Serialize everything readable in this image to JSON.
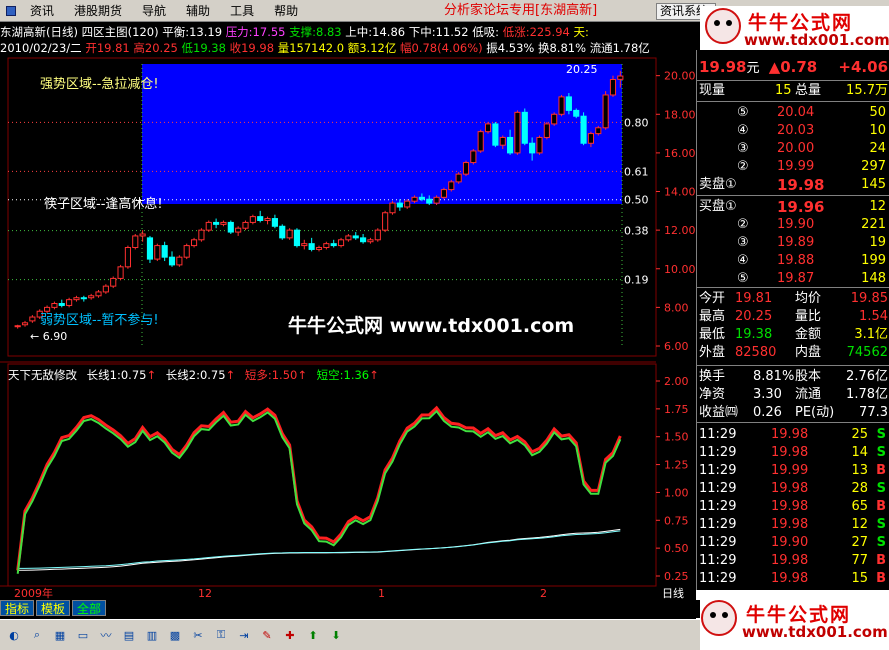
{
  "menu": {
    "items": [
      "资讯",
      "港股期货",
      "导航",
      "辅助",
      "工具",
      "帮助"
    ],
    "title": "分析家论坛专用",
    "title_stock": "[东湖高新]",
    "button": "资讯系统"
  },
  "logo": {
    "text": "牛牛公式网",
    "url": "www.tdx001.com"
  },
  "header": {
    "name": "东湖高新(日线)",
    "view": "四区主图(120)",
    "pingheng": "平衡:13.19",
    "yali": "压力:17.55",
    "zhicheng": "支撑:8.83",
    "shangzhong": "上中:14.86",
    "xiazhong": "下中:11.52",
    "dixi": "低吸:",
    "dizhang": "低涨:225.94",
    "tian": "天:",
    "date": "2010/02/23/二",
    "kai": "开19.81",
    "gao": "高20.25",
    "di": "低19.38",
    "shou": "收19.98",
    "liang": "量157142.0",
    "e": "额3.12亿",
    "fu": "幅0.78(4.06%)",
    "zhen": "振4.53%",
    "huan": "换8.81%",
    "liutong": "流通1.78亿"
  },
  "chart_text": {
    "zone_strong": "强势区域--急拉减仓!",
    "zone_bamboo": "筷子区域--逢高休息!",
    "zone_weak": "弱势区域--暂不参与!",
    "watermark": "牛牛公式网 www.tdx001.com",
    "low_label": "← 6.90",
    "high_label": "20.25",
    "ratio_labels": [
      "0.80",
      "0.61",
      "0.50",
      "0.38",
      "0.19"
    ],
    "price_ticks": [
      "20.00",
      "18.00",
      "16.00",
      "14.00",
      "12.00",
      "10.00",
      "8.00",
      "6.00"
    ],
    "indicator_title": "天下无敌修改",
    "ind_long1": "长线1:0.75",
    "ind_long2": "长线2:0.75",
    "ind_short_long": "短多:1.50",
    "ind_short_empty": "短空:1.36",
    "ind_ticks": [
      "2.00",
      "1.75",
      "1.50",
      "1.25",
      "1.00",
      "0.75",
      "0.50",
      "0.25"
    ],
    "x_labels": [
      "2009年",
      "12",
      "1",
      "2"
    ],
    "day_label": "日线"
  },
  "chart_data": {
    "type": "candlestick",
    "ylim": [
      6.0,
      20.5
    ],
    "candles": [
      [
        7.0,
        7.1,
        7.05,
        6.9
      ],
      [
        7.1,
        7.3,
        7.2,
        7.0
      ],
      [
        7.3,
        7.6,
        7.5,
        7.2
      ],
      [
        7.5,
        7.9,
        7.8,
        7.4
      ],
      [
        7.8,
        8.1,
        8.0,
        7.7
      ],
      [
        8.0,
        8.3,
        8.2,
        7.9
      ],
      [
        8.2,
        8.4,
        8.1,
        8.0
      ],
      [
        8.1,
        8.5,
        8.4,
        8.0
      ],
      [
        8.4,
        8.6,
        8.5,
        8.3
      ],
      [
        8.5,
        8.6,
        8.45,
        8.3
      ],
      [
        8.5,
        8.7,
        8.6,
        8.4
      ],
      [
        8.6,
        8.9,
        8.8,
        8.5
      ],
      [
        8.8,
        9.2,
        9.1,
        8.7
      ],
      [
        9.1,
        9.6,
        9.5,
        9.0
      ],
      [
        9.5,
        10.2,
        10.1,
        9.4
      ],
      [
        10.1,
        11.2,
        11.1,
        10.0
      ],
      [
        11.1,
        11.8,
        11.7,
        11.0
      ],
      [
        11.7,
        12.0,
        11.8,
        11.4
      ],
      [
        11.6,
        11.7,
        10.5,
        10.3
      ],
      [
        10.5,
        11.3,
        11.2,
        10.4
      ],
      [
        11.2,
        11.4,
        10.6,
        10.4
      ],
      [
        10.6,
        10.9,
        10.2,
        10.1
      ],
      [
        10.2,
        10.7,
        10.6,
        10.1
      ],
      [
        10.6,
        11.3,
        11.2,
        10.5
      ],
      [
        11.2,
        11.6,
        11.5,
        11.1
      ],
      [
        11.5,
        12.1,
        12.0,
        11.4
      ],
      [
        12.0,
        12.5,
        12.4,
        11.9
      ],
      [
        12.4,
        12.6,
        12.3,
        12.1
      ],
      [
        12.3,
        12.5,
        12.4,
        12.2
      ],
      [
        12.4,
        12.5,
        11.9,
        11.8
      ],
      [
        11.9,
        12.2,
        12.1,
        11.7
      ],
      [
        12.1,
        12.5,
        12.4,
        12.0
      ],
      [
        12.4,
        12.8,
        12.7,
        12.3
      ],
      [
        12.7,
        13.0,
        12.5,
        12.4
      ],
      [
        12.5,
        12.7,
        12.6,
        12.3
      ],
      [
        12.6,
        12.8,
        12.2,
        12.1
      ],
      [
        12.2,
        12.3,
        11.6,
        11.5
      ],
      [
        11.6,
        12.1,
        12.0,
        11.5
      ],
      [
        12.0,
        12.1,
        11.2,
        11.1
      ],
      [
        11.2,
        11.5,
        11.3,
        11.0
      ],
      [
        11.3,
        11.6,
        11.0,
        10.9
      ],
      [
        11.0,
        11.2,
        11.1,
        10.9
      ],
      [
        11.1,
        11.4,
        11.3,
        11.0
      ],
      [
        11.3,
        11.5,
        11.2,
        11.1
      ],
      [
        11.2,
        11.6,
        11.5,
        11.1
      ],
      [
        11.5,
        11.8,
        11.7,
        11.4
      ],
      [
        11.7,
        11.9,
        11.6,
        11.5
      ],
      [
        11.6,
        11.8,
        11.4,
        11.3
      ],
      [
        11.4,
        11.6,
        11.5,
        11.3
      ],
      [
        11.5,
        12.1,
        12.0,
        11.4
      ],
      [
        12.0,
        13.0,
        12.9,
        11.9
      ],
      [
        12.9,
        13.5,
        13.4,
        12.8
      ],
      [
        13.4,
        13.6,
        13.2,
        13.0
      ],
      [
        13.2,
        13.6,
        13.5,
        13.1
      ],
      [
        13.5,
        13.8,
        13.7,
        13.4
      ],
      [
        13.7,
        13.9,
        13.6,
        13.5
      ],
      [
        13.6,
        13.8,
        13.4,
        13.3
      ],
      [
        13.4,
        13.8,
        13.7,
        13.3
      ],
      [
        13.7,
        14.2,
        14.1,
        13.6
      ],
      [
        14.1,
        14.6,
        14.5,
        14.0
      ],
      [
        14.5,
        15.0,
        14.9,
        14.4
      ],
      [
        14.9,
        15.6,
        15.5,
        14.8
      ],
      [
        15.5,
        16.2,
        16.1,
        15.4
      ],
      [
        16.1,
        17.2,
        17.1,
        16.0
      ],
      [
        17.1,
        17.6,
        17.5,
        17.0
      ],
      [
        17.5,
        17.6,
        16.4,
        16.3
      ],
      [
        16.4,
        16.9,
        16.8,
        16.2
      ],
      [
        16.8,
        17.2,
        16.0,
        15.9
      ],
      [
        16.0,
        18.2,
        18.1,
        15.9
      ],
      [
        18.1,
        18.3,
        16.5,
        16.4
      ],
      [
        16.5,
        16.8,
        16.0,
        15.6
      ],
      [
        16.0,
        16.9,
        16.8,
        15.9
      ],
      [
        16.8,
        17.6,
        17.5,
        16.7
      ],
      [
        17.5,
        18.1,
        18.0,
        17.4
      ],
      [
        18.0,
        19.0,
        18.9,
        17.9
      ],
      [
        18.9,
        19.1,
        18.2,
        18.0
      ],
      [
        18.2,
        18.3,
        17.9,
        17.8
      ],
      [
        17.9,
        18.1,
        16.5,
        16.4
      ],
      [
        16.5,
        17.1,
        17.0,
        16.3
      ],
      [
        17.0,
        17.4,
        17.3,
        16.9
      ],
      [
        17.3,
        19.2,
        19.0,
        17.2
      ],
      [
        19.0,
        20.0,
        19.8,
        18.9
      ],
      [
        19.81,
        20.25,
        19.98,
        19.38
      ]
    ]
  },
  "quote": {
    "price": "19.98",
    "price_unit": "元",
    "change": "▲0.78",
    "pct": "+4.06",
    "xianliang_label": "现量",
    "xianliang": "15",
    "zongliang_label": "总量",
    "zongliang": "15.7万",
    "sell": [
      {
        "no": "⑤",
        "price": "20.04",
        "vol": "50"
      },
      {
        "no": "④",
        "price": "20.03",
        "vol": "10"
      },
      {
        "no": "③",
        "price": "20.00",
        "vol": "24"
      },
      {
        "no": "②",
        "price": "19.99",
        "vol": "297"
      },
      {
        "no": "卖盘①",
        "price": "19.98",
        "vol": "145"
      }
    ],
    "buy": [
      {
        "no": "买盘①",
        "price": "19.96",
        "vol": "12"
      },
      {
        "no": "②",
        "price": "19.90",
        "vol": "221"
      },
      {
        "no": "③",
        "price": "19.89",
        "vol": "19"
      },
      {
        "no": "④",
        "price": "19.88",
        "vol": "199"
      },
      {
        "no": "⑤",
        "price": "19.87",
        "vol": "148"
      }
    ],
    "stats": [
      {
        "l1": "今开",
        "v1": "19.81",
        "l2": "均价",
        "v2": "19.85"
      },
      {
        "l1": "最高",
        "v1": "20.25",
        "l2": "量比",
        "v2": "1.54"
      },
      {
        "l1": "最低",
        "v1": "19.38",
        "l2": "金额",
        "v2": "3.1亿"
      },
      {
        "l1": "外盘",
        "v1": "82580",
        "l2": "内盘",
        "v2": "74562"
      }
    ],
    "stats2": [
      {
        "l1": "换手",
        "v1": "8.81%",
        "l2": "股本",
        "v2": "2.76亿"
      },
      {
        "l1": "净资",
        "v1": "3.30",
        "l2": "流通",
        "v2": "1.78亿"
      },
      {
        "l1": "收益㈣",
        "v1": "0.26",
        "l2": "PE(动)",
        "v2": "77.3"
      }
    ],
    "ticks": [
      {
        "t": "11:29",
        "p": "19.98",
        "v": "25",
        "s": "S"
      },
      {
        "t": "11:29",
        "p": "19.98",
        "v": "14",
        "s": "S"
      },
      {
        "t": "11:29",
        "p": "19.99",
        "v": "13",
        "s": "B"
      },
      {
        "t": "11:29",
        "p": "19.98",
        "v": "28",
        "s": "S"
      },
      {
        "t": "11:29",
        "p": "19.98",
        "v": "65",
        "s": "B"
      },
      {
        "t": "11:29",
        "p": "19.98",
        "v": "12",
        "s": "S"
      },
      {
        "t": "11:29",
        "p": "19.90",
        "v": "27",
        "s": "S"
      },
      {
        "t": "11:29",
        "p": "19.98",
        "v": "77",
        "s": "B"
      },
      {
        "t": "11:29",
        "p": "19.98",
        "v": "15",
        "s": "B"
      }
    ]
  },
  "tabs": [
    "指标",
    "模板",
    "全部"
  ]
}
